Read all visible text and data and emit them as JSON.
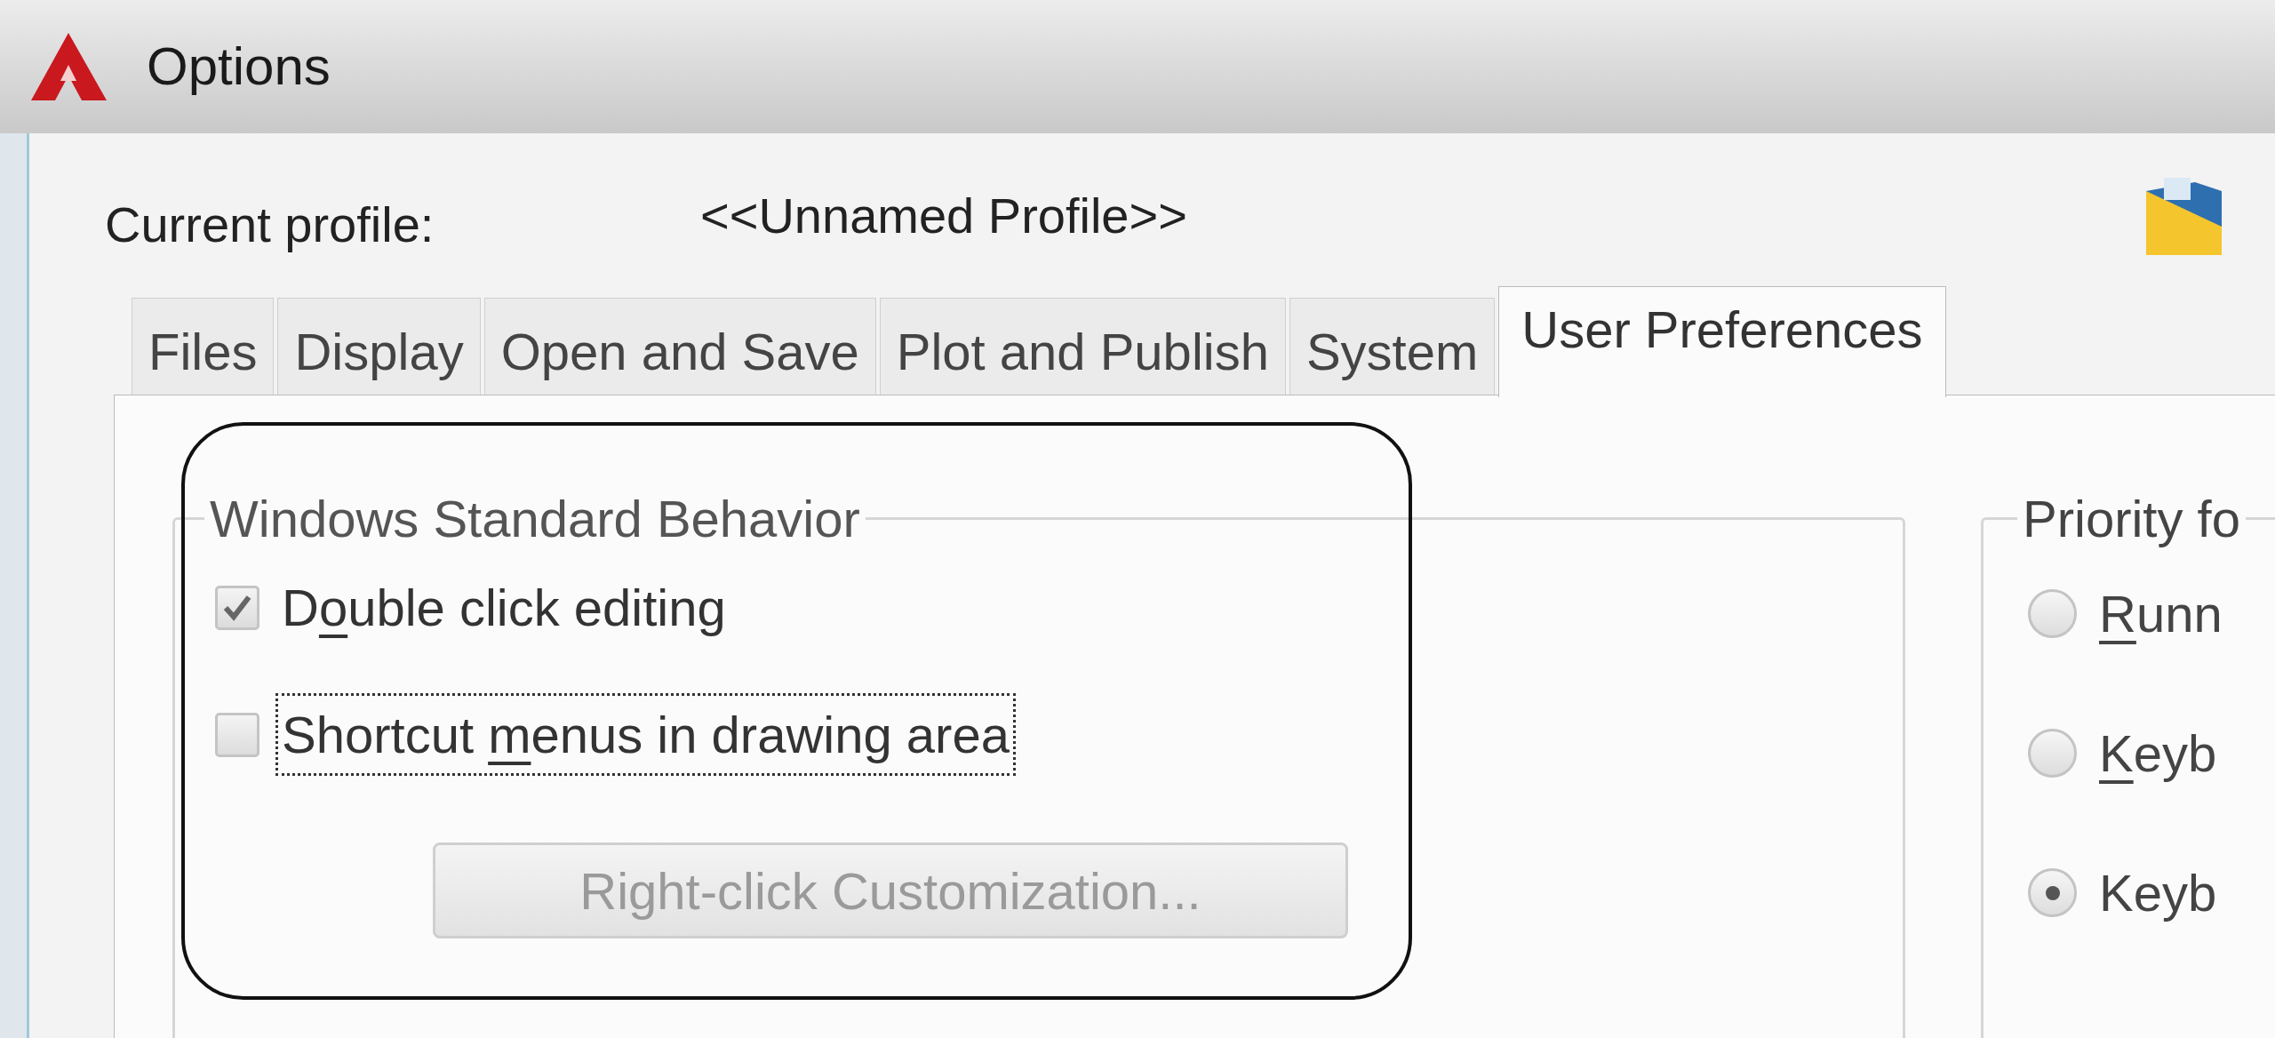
{
  "window": {
    "title": "Options"
  },
  "profile": {
    "label": "Current profile:",
    "value": "<<Unnamed Profile>>"
  },
  "tabs": [
    {
      "label": "Files",
      "selected": false
    },
    {
      "label": "Display",
      "selected": false
    },
    {
      "label": "Open and Save",
      "selected": false
    },
    {
      "label": "Plot and Publish",
      "selected": false
    },
    {
      "label": "System",
      "selected": false
    },
    {
      "label": "User Preferences",
      "selected": true
    }
  ],
  "windows_standard_behavior": {
    "title": "Windows Standard Behavior",
    "checkboxes": [
      {
        "label_parts": [
          {
            "text": "D",
            "underline": false
          },
          {
            "text": "o",
            "underline": true
          },
          {
            "text": "uble click editing",
            "underline": false
          }
        ],
        "checked": true,
        "focused": false
      },
      {
        "label_parts": [
          {
            "text": "Shortcut ",
            "underline": false
          },
          {
            "text": "m",
            "underline": true
          },
          {
            "text": "enus in drawing area",
            "underline": false
          }
        ],
        "checked": false,
        "focused": true
      }
    ],
    "button": {
      "label": "Right-click Customization...",
      "disabled": true
    }
  },
  "priority_group": {
    "title": "Priority fo",
    "radios": [
      {
        "label_parts": [
          {
            "text": "R",
            "underline": true
          },
          {
            "text": "unn",
            "underline": false
          }
        ],
        "selected": false
      },
      {
        "label_parts": [
          {
            "text": "K",
            "underline": true
          },
          {
            "text": "eyb",
            "underline": false
          }
        ],
        "selected": false
      },
      {
        "label_parts": [
          {
            "text": "Keyb",
            "underline": false
          }
        ],
        "selected": true
      }
    ]
  }
}
